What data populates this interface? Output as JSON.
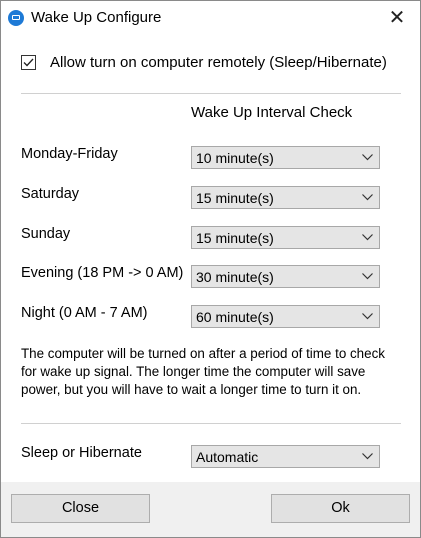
{
  "window": {
    "title": "Wake Up Configure",
    "close_glyph": "✕",
    "icon": "app-icon"
  },
  "allow_remote": {
    "label": "Allow turn on computer remotely (Sleep/Hibernate)",
    "checked": true
  },
  "interval_header": "Wake Up Interval Check",
  "schedule": [
    {
      "label": "Monday-Friday",
      "value": "10 minute(s)"
    },
    {
      "label": "Saturday",
      "value": "15 minute(s)"
    },
    {
      "label": "Sunday",
      "value": "15 minute(s)"
    },
    {
      "label": "Evening (18 PM -> 0 AM)",
      "value": "30 minute(s)"
    },
    {
      "label": "Night (0 AM - 7 AM)",
      "value": "60 minute(s)"
    }
  ],
  "note": "The computer will be turned on after a period of time to check for wake up signal. The longer time the computer will save power, but you will have to wait a longer time to turn it on.",
  "sleep_mode": {
    "label": "Sleep or Hibernate",
    "value": "Automatic"
  },
  "buttons": {
    "close": "Close",
    "ok": "Ok"
  }
}
